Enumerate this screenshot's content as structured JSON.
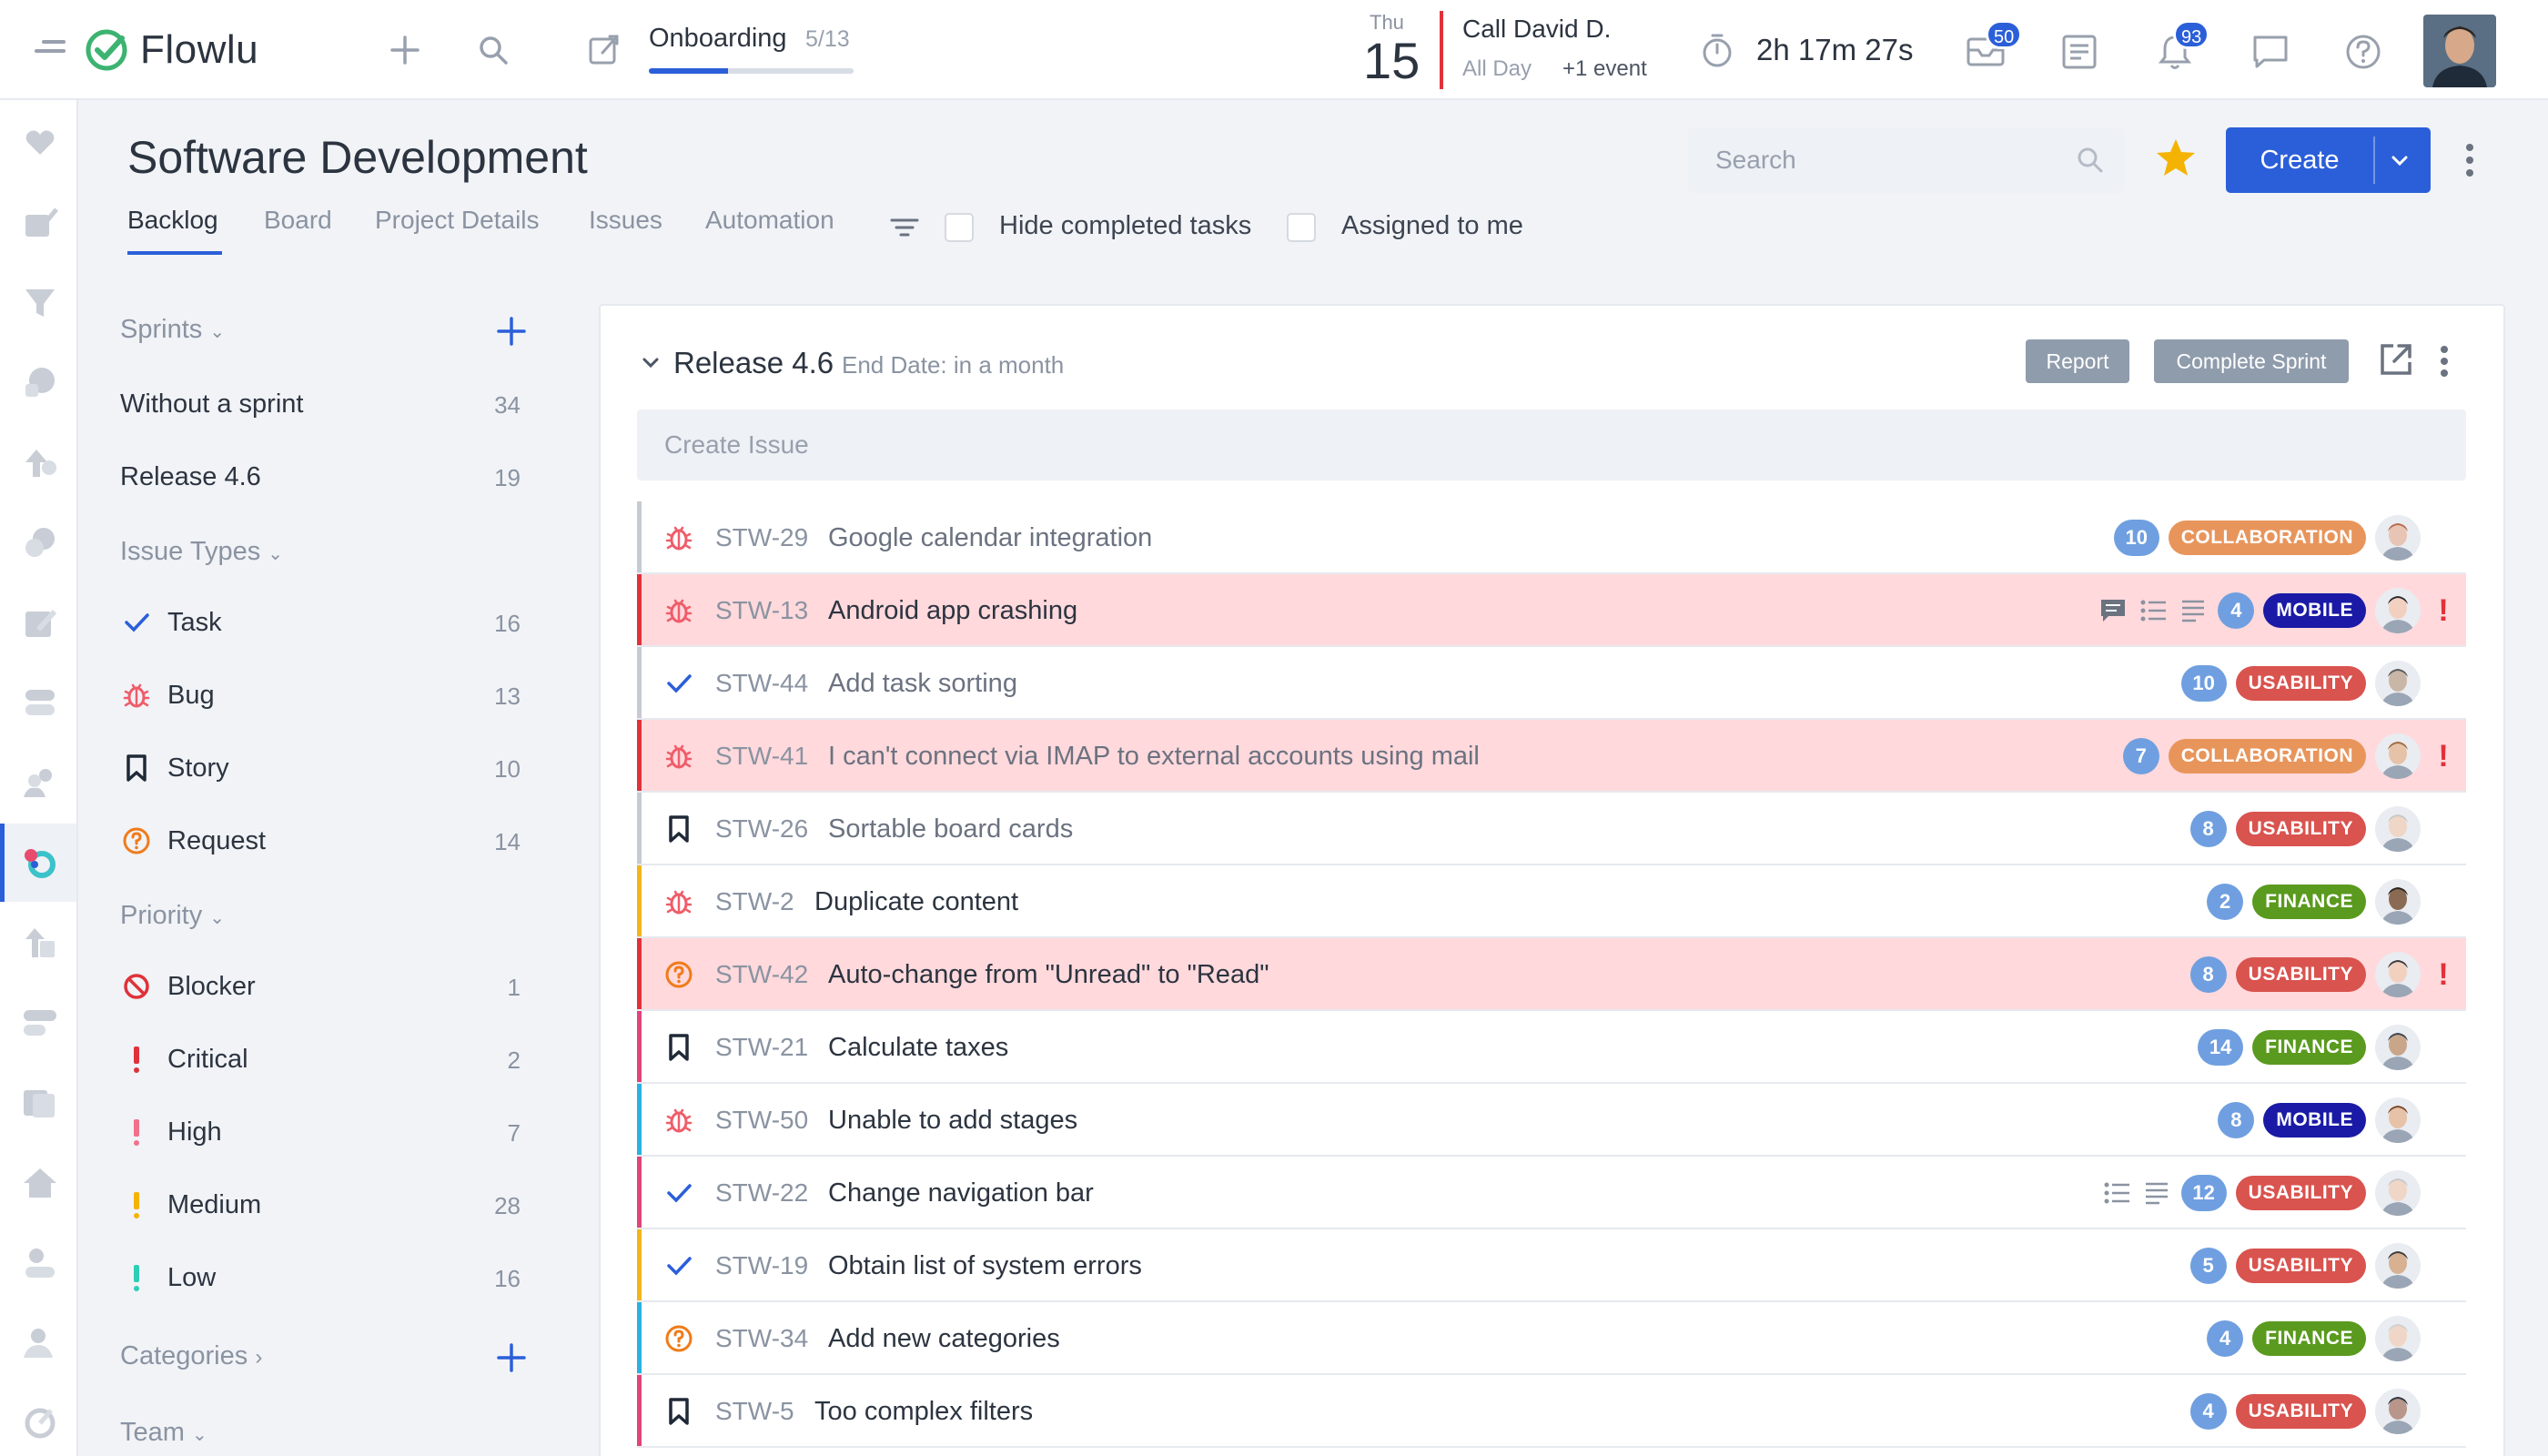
{
  "app": {
    "name": "Flowlu",
    "brand_color": "#2b5fd9",
    "accent_green": "#3cb371"
  },
  "topbar": {
    "onboarding": {
      "label": "Onboarding",
      "count": "5/13",
      "progress": 0.385
    },
    "calendar": {
      "dow": "Thu",
      "day": "15",
      "title": "Call David D.",
      "sub": "All Day",
      "more": "+1 event"
    },
    "timer": "2h 17m 27s",
    "mail_badge": "50",
    "notif_badge": "93"
  },
  "header": {
    "title": "Software Development",
    "tabs": [
      "Backlog",
      "Board",
      "Project Details",
      "Issues",
      "Automation"
    ],
    "active_tab": "Backlog",
    "hide_completed_label": "Hide completed tasks",
    "assigned_label": "Assigned to me",
    "search_placeholder": "Search",
    "create_label": "Create"
  },
  "sidebar": {
    "sprints_label": "Sprints",
    "sprints": [
      {
        "label": "Without a sprint",
        "count": "34"
      },
      {
        "label": "Release 4.6",
        "count": "19"
      }
    ],
    "issue_types_label": "Issue Types",
    "issue_types": [
      {
        "label": "Task",
        "count": "16",
        "icon": "check-icon"
      },
      {
        "label": "Bug",
        "count": "13",
        "icon": "bug-icon"
      },
      {
        "label": "Story",
        "count": "10",
        "icon": "bookmark-icon"
      },
      {
        "label": "Request",
        "count": "14",
        "icon": "question-circle-icon"
      }
    ],
    "priority_label": "Priority",
    "priorities": [
      {
        "label": "Blocker",
        "count": "1",
        "icon": "blocker-icon"
      },
      {
        "label": "Critical",
        "count": "2",
        "icon": "exclamation-red-icon"
      },
      {
        "label": "High",
        "count": "7",
        "icon": "exclamation-pink-icon"
      },
      {
        "label": "Medium",
        "count": "28",
        "icon": "exclamation-yellow-icon"
      },
      {
        "label": "Low",
        "count": "16",
        "icon": "exclamation-teal-icon"
      }
    ],
    "categories_label": "Categories",
    "team_label": "Team"
  },
  "sprint": {
    "title": "Release 4.6",
    "end_date": "End Date: in a month",
    "report_label": "Report",
    "complete_label": "Complete Sprint",
    "create_issue_placeholder": "Create Issue",
    "issues": [
      {
        "key": "STW-29",
        "title": "Google calendar integration",
        "type": "bug",
        "points": "10",
        "tag": "COLLABORATION",
        "tag_color": "#e8955c",
        "stripe": "#c5cad3",
        "highlight": false,
        "priority": false,
        "muted": true,
        "extras": []
      },
      {
        "key": "STW-13",
        "title": "Android app crashing",
        "type": "bug",
        "points": "4",
        "tag": "MOBILE",
        "tag_color": "#1a1aa6",
        "stripe": "#e0323a",
        "highlight": true,
        "priority": true,
        "muted": false,
        "extras": [
          "comment-icon",
          "checklist-icon",
          "description-icon"
        ]
      },
      {
        "key": "STW-44",
        "title": "Add task sorting",
        "type": "task",
        "points": "10",
        "tag": "USABILITY",
        "tag_color": "#d9534f",
        "stripe": "#c5cad3",
        "highlight": false,
        "priority": false,
        "muted": true,
        "extras": []
      },
      {
        "key": "STW-41",
        "title": "I can't connect via IMAP to external accounts using mail",
        "type": "bug",
        "points": "7",
        "tag": "COLLABORATION",
        "tag_color": "#e8955c",
        "stripe": "#e0323a",
        "highlight": true,
        "priority": true,
        "muted": true,
        "extras": []
      },
      {
        "key": "STW-26",
        "title": "Sortable board cards",
        "type": "story",
        "points": "8",
        "tag": "USABILITY",
        "tag_color": "#d9534f",
        "stripe": "#c5cad3",
        "highlight": false,
        "priority": false,
        "muted": true,
        "extras": []
      },
      {
        "key": "STW-2",
        "title": "Duplicate content",
        "type": "bug",
        "points": "2",
        "tag": "FINANCE",
        "tag_color": "#5a9a1e",
        "stripe": "#f2b51c",
        "highlight": false,
        "priority": false,
        "muted": false,
        "extras": []
      },
      {
        "key": "STW-42",
        "title": "Auto-change from \"Unread\" to \"Read\"",
        "type": "request",
        "points": "8",
        "tag": "USABILITY",
        "tag_color": "#d9534f",
        "stripe": "#e0323a",
        "highlight": true,
        "priority": true,
        "muted": false,
        "extras": []
      },
      {
        "key": "STW-21",
        "title": "Calculate taxes",
        "type": "story",
        "points": "14",
        "tag": "FINANCE",
        "tag_color": "#5a9a1e",
        "stripe": "#e0447a",
        "highlight": false,
        "priority": false,
        "muted": false,
        "extras": []
      },
      {
        "key": "STW-50",
        "title": "Unable to add stages",
        "type": "bug",
        "points": "8",
        "tag": "MOBILE",
        "tag_color": "#1a1aa6",
        "stripe": "#2bb0e0",
        "highlight": false,
        "priority": false,
        "muted": false,
        "extras": []
      },
      {
        "key": "STW-22",
        "title": "Change navigation bar",
        "type": "task",
        "points": "12",
        "tag": "USABILITY",
        "tag_color": "#d9534f",
        "stripe": "#e0447a",
        "highlight": false,
        "priority": false,
        "muted": false,
        "extras": [
          "checklist-icon",
          "description-icon"
        ]
      },
      {
        "key": "STW-19",
        "title": "Obtain list of system errors",
        "type": "task",
        "points": "5",
        "tag": "USABILITY",
        "tag_color": "#d9534f",
        "stripe": "#f2b51c",
        "highlight": false,
        "priority": false,
        "muted": false,
        "extras": []
      },
      {
        "key": "STW-34",
        "title": "Add new categories",
        "type": "request",
        "points": "4",
        "tag": "FINANCE",
        "tag_color": "#5a9a1e",
        "stripe": "#2bb0e0",
        "highlight": false,
        "priority": false,
        "muted": false,
        "extras": []
      },
      {
        "key": "STW-5",
        "title": "Too complex filters",
        "type": "story",
        "points": "4",
        "tag": "USABILITY",
        "tag_color": "#d9534f",
        "stripe": "#e0447a",
        "highlight": false,
        "priority": false,
        "muted": false,
        "extras": []
      }
    ]
  }
}
